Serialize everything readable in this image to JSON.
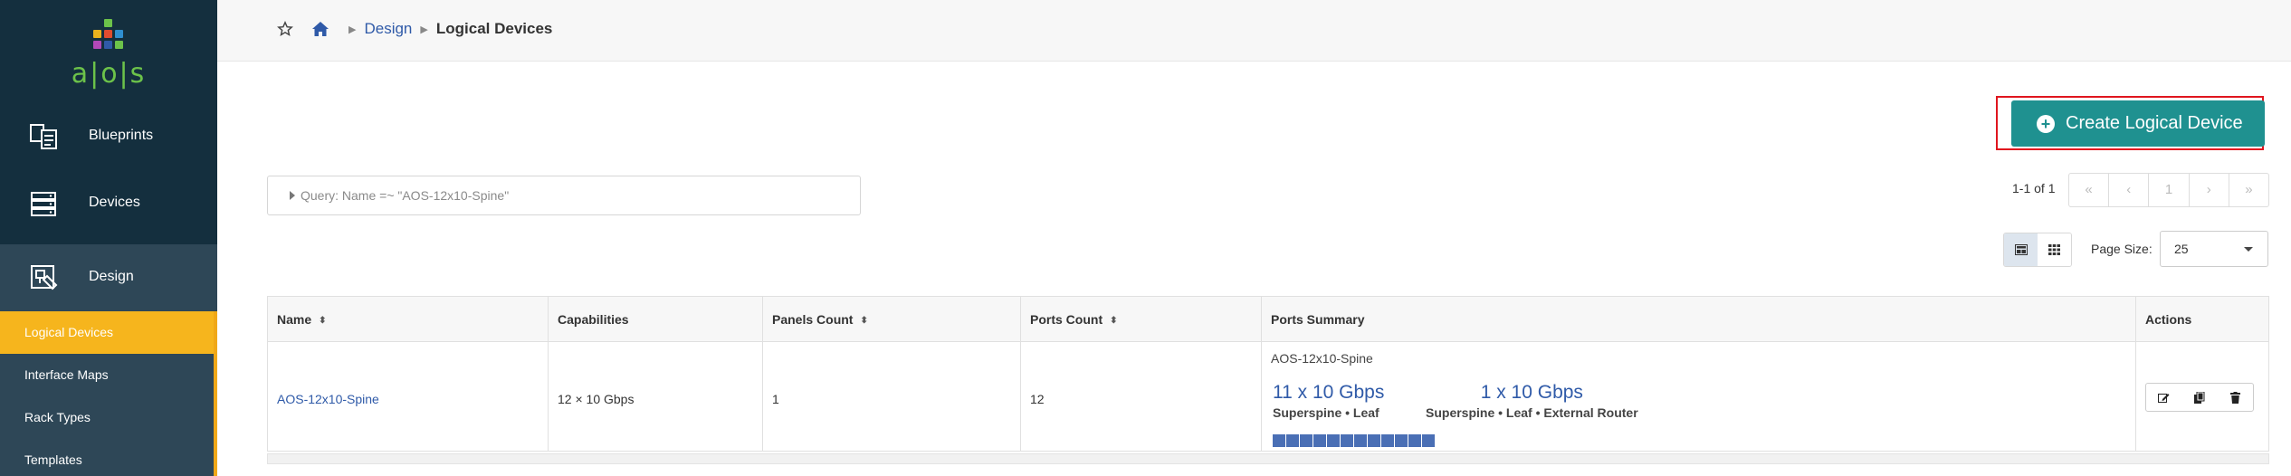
{
  "app": {
    "logo_text": "a|o|s",
    "colors": {
      "sidebar": "#142f3e",
      "submenu": "#2e4757",
      "accent": "#f6b51d",
      "primary": "#1f9190",
      "link": "#2f5aa8",
      "highlight": "#e0161e"
    }
  },
  "sidebar": {
    "items": [
      {
        "label": "Blueprints",
        "icon": "blueprints-icon"
      },
      {
        "label": "Devices",
        "icon": "devices-icon"
      },
      {
        "label": "Design",
        "icon": "design-icon"
      }
    ],
    "submenu": [
      {
        "label": "Logical Devices",
        "selected": true
      },
      {
        "label": "Interface Maps"
      },
      {
        "label": "Rack Types"
      },
      {
        "label": "Templates"
      }
    ]
  },
  "breadcrumb": {
    "icons": [
      "star-icon",
      "home-icon"
    ],
    "design": "Design",
    "current": "Logical Devices"
  },
  "toolbar": {
    "create_label": "Create Logical Device"
  },
  "query": {
    "text": "Query: Name =~ \"AOS-12x10-Spine\""
  },
  "pagination": {
    "info": "1-1 of 1",
    "buttons": [
      "«",
      "‹",
      "1",
      "›",
      "»"
    ],
    "page_size_label": "Page Size:",
    "page_size": "25"
  },
  "table": {
    "columns": [
      "Name",
      "Capabilities",
      "Panels Count",
      "Ports Count",
      "Ports Summary",
      "Actions"
    ],
    "rows": [
      {
        "name": "AOS-12x10-Spine",
        "capabilities": "12 × 10 Gbps",
        "panels_count": "1",
        "ports_count": "12",
        "ports_summary": {
          "title": "AOS-12x10-Spine",
          "groups": [
            {
              "speed": "11 x 10 Gbps",
              "roles": "Superspine • Leaf"
            },
            {
              "speed": "1 x 10 Gbps",
              "roles": "Superspine • Leaf • External Router"
            }
          ],
          "port_count": 12
        },
        "actions": [
          "edit-icon",
          "clone-icon",
          "delete-icon"
        ]
      }
    ]
  }
}
